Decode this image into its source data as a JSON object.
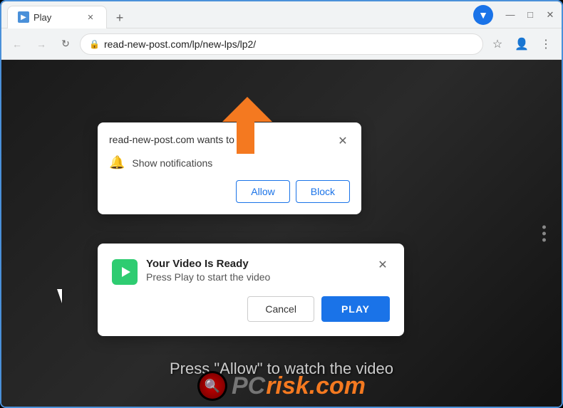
{
  "browser": {
    "tab": {
      "title": "Play",
      "favicon": "▶"
    },
    "new_tab_label": "+",
    "controls": {
      "minimize": "—",
      "maximize": "□",
      "close": "✕"
    },
    "nav": {
      "back": "←",
      "forward": "→",
      "refresh": "↻"
    },
    "address": "read-new-post.com/lp/new-lps/lp2/",
    "star_icon": "☆",
    "menu_icon": "⋮"
  },
  "notification_popup": {
    "title": "read-new-post.com wants to",
    "close_icon": "✕",
    "bell_icon": "🔔",
    "notification_label": "Show notifications",
    "btn_allow": "Allow",
    "btn_block": "Block"
  },
  "video_popup": {
    "close_icon": "✕",
    "title": "Your Video Is Ready",
    "subtitle": "Press Play to start the video",
    "btn_cancel": "Cancel",
    "btn_play": "PLAY"
  },
  "page_overlay": {
    "press_allow_text": "Press \"Allow\" to watch the video"
  },
  "pcrisk": {
    "gray_text": "PC",
    "orange_text": "risk.com"
  }
}
